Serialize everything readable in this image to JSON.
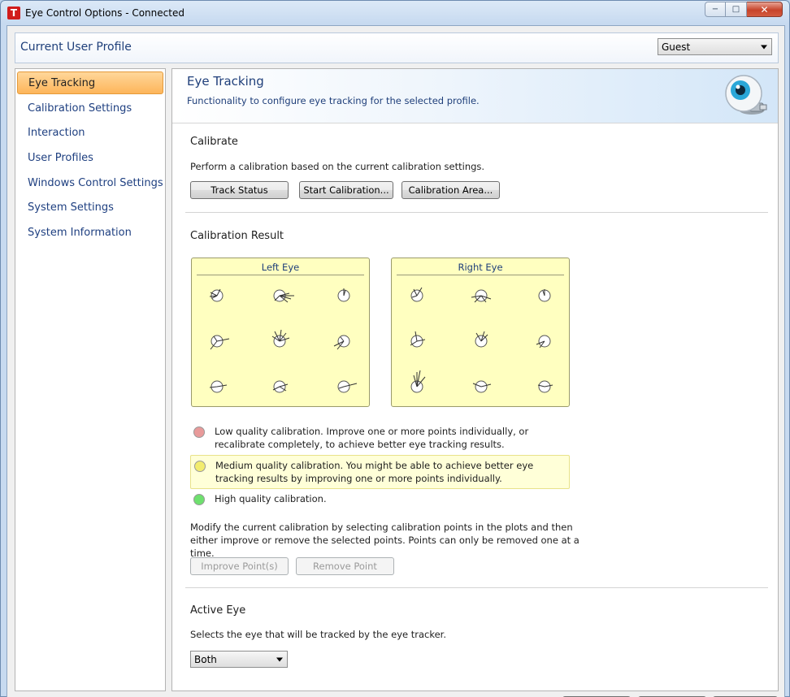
{
  "window": {
    "title": "Eye Control Options - Connected",
    "app_icon_letter": "T",
    "caption": {
      "minimize": "−",
      "maximize": "□",
      "close": "✕"
    }
  },
  "profile": {
    "label": "Current User Profile",
    "selected": "Guest"
  },
  "sidebar": {
    "items": [
      {
        "label": "Eye Tracking",
        "active": true
      },
      {
        "label": "Calibration Settings"
      },
      {
        "label": "Interaction"
      },
      {
        "label": "User Profiles"
      },
      {
        "label": "Windows Control Settings"
      },
      {
        "label": "System Settings"
      },
      {
        "label": "System Information"
      }
    ]
  },
  "header": {
    "title": "Eye Tracking",
    "subtitle": "Functionality to configure eye tracking for the selected profile.",
    "icon": "eye-tracker-icon"
  },
  "calibrate": {
    "title": "Calibrate",
    "description": "Perform a calibration based on the current calibration settings.",
    "buttons": {
      "track_status": "Track Status",
      "start_calibration": "Start Calibration...",
      "calibration_area": "Calibration Area..."
    }
  },
  "result": {
    "title": "Calibration Result",
    "left_eye": "Left Eye",
    "right_eye": "Right Eye",
    "quality": {
      "low": "Low quality calibration. Improve one or more points individually, or recalibrate completely, to achieve better eye tracking results.",
      "medium": "Medium quality calibration. You might be able to achieve better eye tracking results by improving one or more points individually.",
      "high": "High quality calibration."
    },
    "quality_colors": {
      "low": "#e89a9a",
      "medium": "#f2ec6e",
      "high": "#6ee06e"
    },
    "modify_text": "Modify the current calibration by selecting calibration points in the plots and then either improve or remove the selected points. Points can only be removed one at a time.",
    "improve_button": "Improve Point(s)",
    "remove_button": "Remove Point"
  },
  "active_eye": {
    "title": "Active Eye",
    "description": "Selects the eye that will be tracked by the eye tracker.",
    "selected": "Both"
  }
}
